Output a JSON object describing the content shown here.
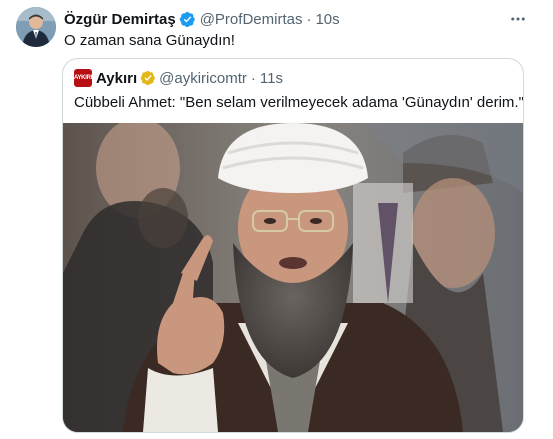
{
  "tweet": {
    "author_name": "Özgür Demirtaş",
    "author_handle": "@ProfDemirtas",
    "separator": "·",
    "time": "10s",
    "text": "O zaman sana Günaydın!",
    "more_icon": "more-horizontal-icon"
  },
  "quote": {
    "author_name": "Aykırı",
    "avatar_text": "AYKIRI",
    "author_handle": "@aykiricomtr",
    "separator": "·",
    "time": "11s",
    "text": "Cübbeli Ahmet: \"Ben selam verilmeyecek adama 'Günaydın' derim.\""
  },
  "colors": {
    "blue_verified": "#1d9bf0",
    "gold_verified": "#e2b719",
    "secondary_text": "#536471",
    "border": "#cfd9de",
    "brand_red": "#b80f14"
  }
}
